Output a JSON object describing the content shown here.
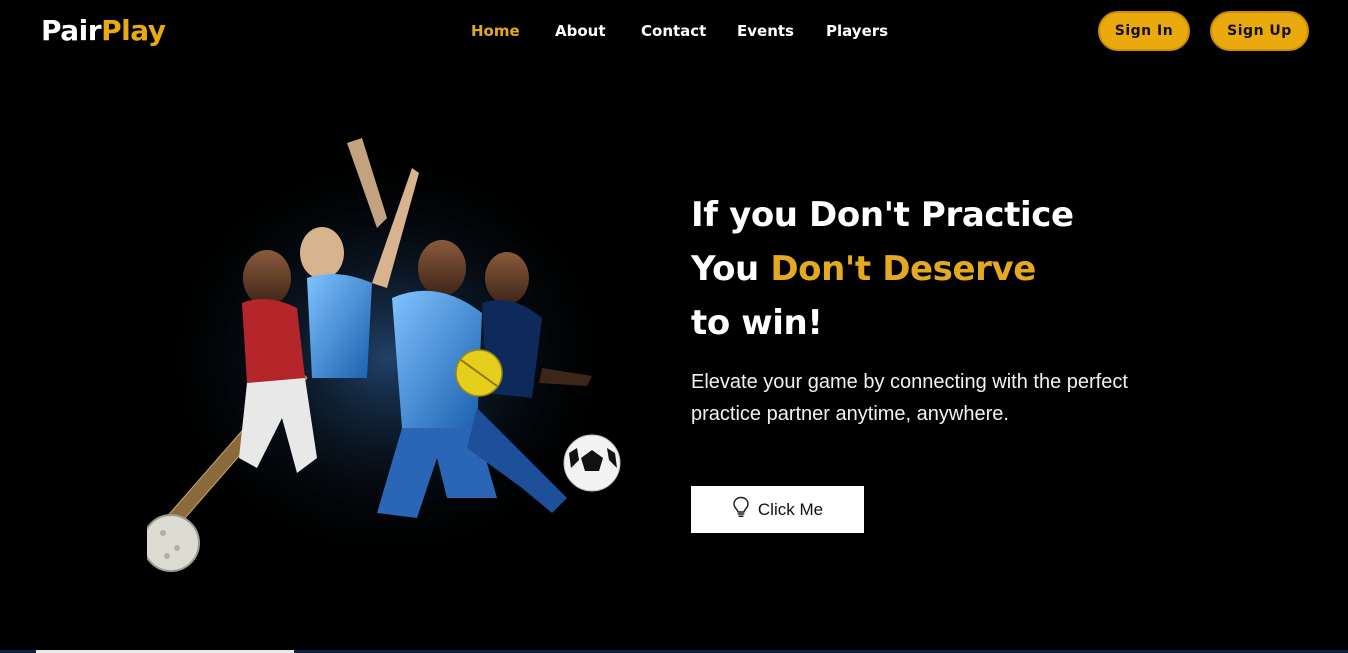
{
  "brand": {
    "part1": "Pair",
    "part2": "Play"
  },
  "nav": {
    "items": [
      {
        "label": "Home",
        "active": true
      },
      {
        "label": "About",
        "active": false
      },
      {
        "label": "Contact",
        "active": false
      },
      {
        "label": "Events",
        "active": false
      },
      {
        "label": "Players",
        "active": false
      }
    ]
  },
  "auth": {
    "sign_in": "Sign In",
    "sign_up": "Sign Up"
  },
  "hero": {
    "line1": "If you Don't Practice",
    "line2_plain": "You ",
    "line2_highlight": "Don't Deserve",
    "line3": "to win!",
    "description": "Elevate your game by connecting with the perfect practice partner anytime, anywhere.",
    "cta_label": "Click Me",
    "cta_icon": "lightbulb-icon",
    "image_subject": "athletes-collage"
  },
  "colors": {
    "background": "#000000",
    "accent": "#eaa90c",
    "text": "#ffffff"
  }
}
